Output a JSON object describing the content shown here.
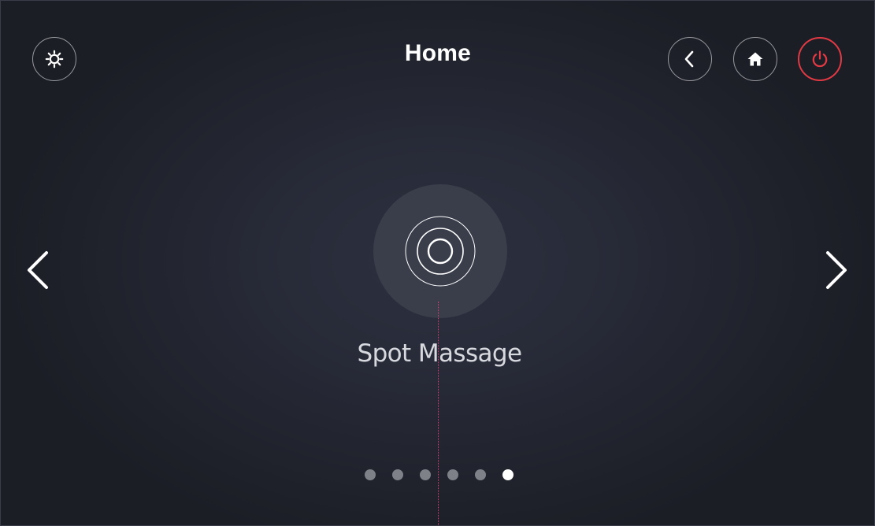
{
  "header": {
    "title": "Home",
    "buttons": {
      "settings": {
        "icon": "gear-icon"
      },
      "back": {
        "icon": "chevron-left-icon"
      },
      "home": {
        "icon": "home-icon"
      },
      "power": {
        "icon": "power-icon",
        "color": "#e23a44"
      }
    }
  },
  "carousel": {
    "current_mode": {
      "label": "Spot Massage",
      "icon": "concentric-circles-icon"
    },
    "prev_icon": "chevron-left-icon",
    "next_icon": "chevron-right-icon",
    "pager": {
      "total": 6,
      "active_index": 5,
      "dot_color": "#7f8188",
      "active_color": "#ffffff"
    }
  },
  "colors": {
    "background": "#272a37",
    "accent_power": "#e23a44",
    "guide_line": "#d23c6e"
  }
}
